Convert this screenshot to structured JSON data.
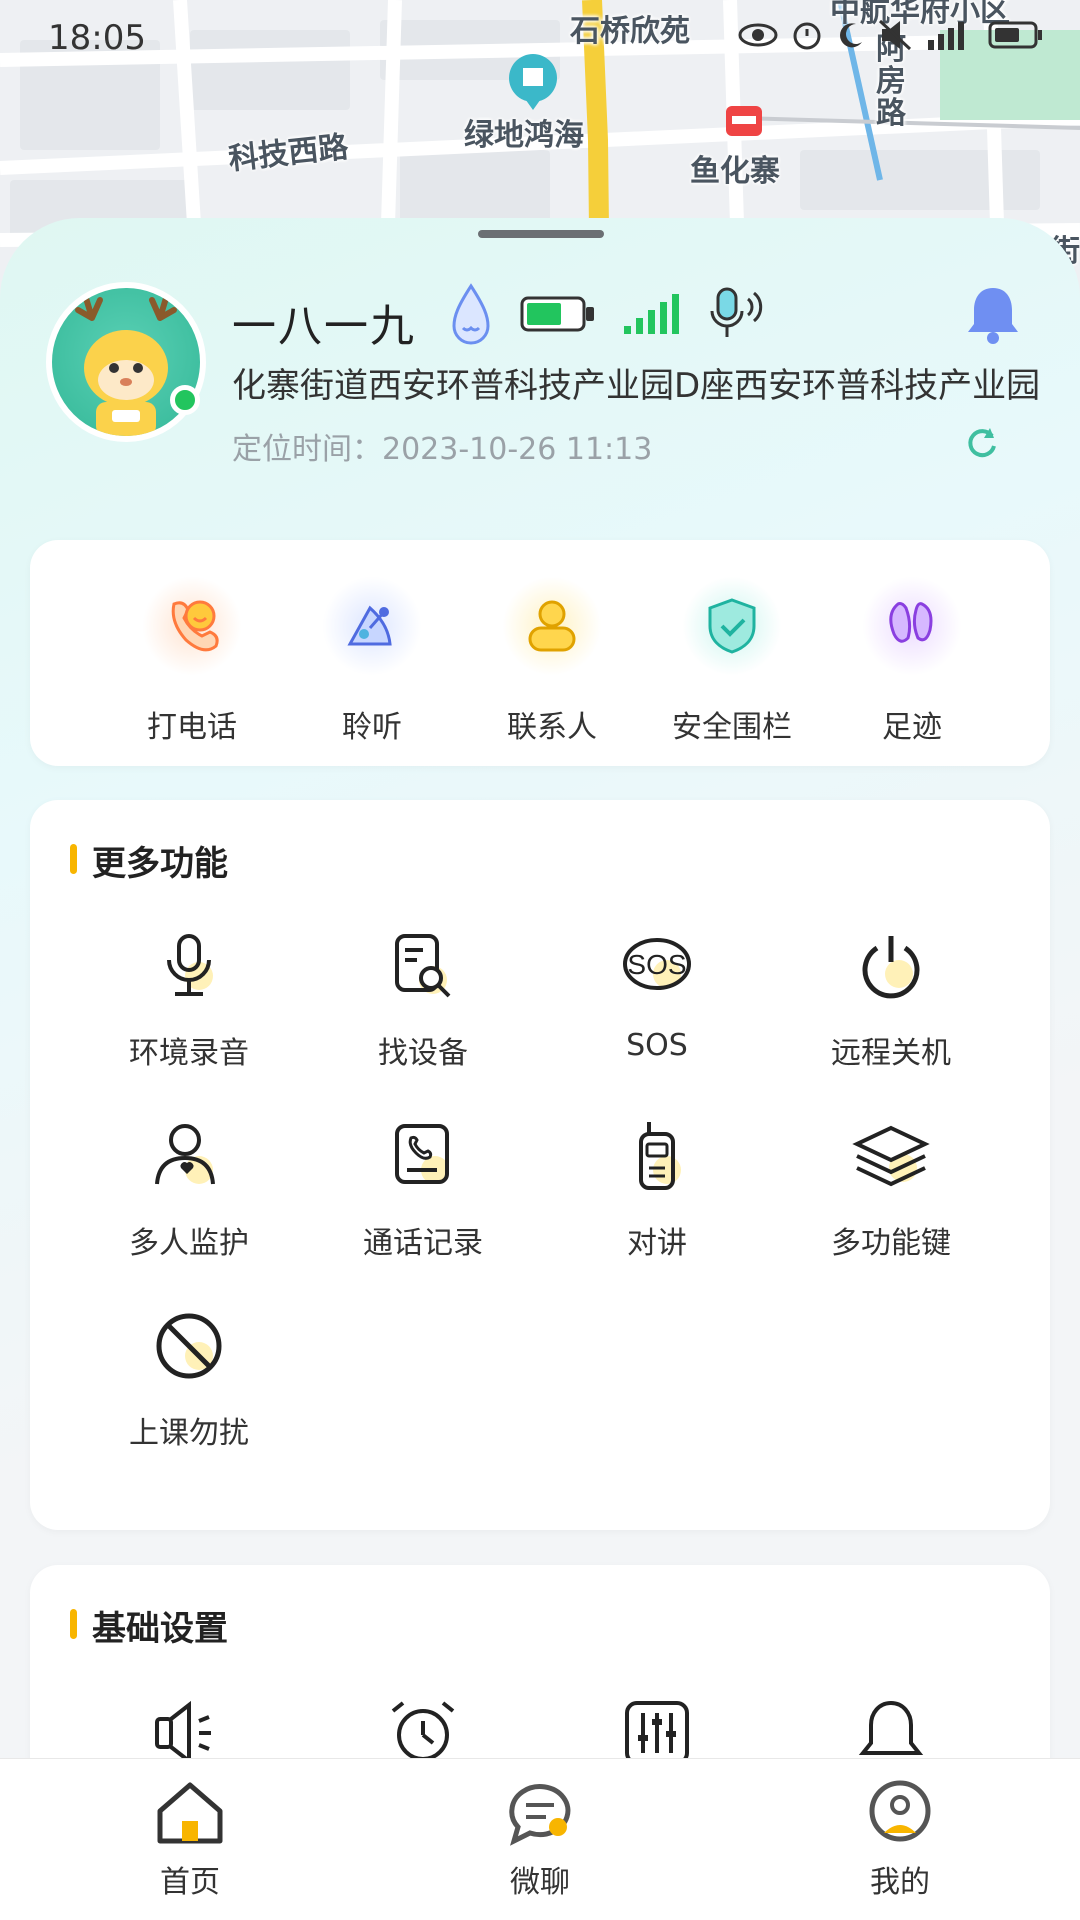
{
  "status_bar": {
    "time": "18:05"
  },
  "map": {
    "labels": [
      "石桥欣苑",
      "中航华府小区",
      "科技西路",
      "绿地鸿海",
      "鱼化寨",
      "阿房路",
      "街"
    ]
  },
  "device": {
    "name": "一八一九",
    "address": "化寨街道西安环普科技产业园D座西安环普科技产业园",
    "location_time": "定位时间：2023-10-26 11:13"
  },
  "quick_actions": [
    {
      "label": "打电话",
      "icon": "phone-icon"
    },
    {
      "label": "聆听",
      "icon": "satellite-icon"
    },
    {
      "label": "联系人",
      "icon": "contact-icon"
    },
    {
      "label": "安全围栏",
      "icon": "shield-icon"
    },
    {
      "label": "足迹",
      "icon": "footprint-icon"
    }
  ],
  "more_functions": {
    "title": "更多功能",
    "items": [
      {
        "label": "环境录音",
        "icon": "microphone-icon"
      },
      {
        "label": "找设备",
        "icon": "find-device-icon"
      },
      {
        "label": "SOS",
        "icon": "sos-icon",
        "icon_text": "SOS"
      },
      {
        "label": "远程关机",
        "icon": "power-icon"
      },
      {
        "label": "多人监护",
        "icon": "guardian-icon"
      },
      {
        "label": "通话记录",
        "icon": "call-log-icon"
      },
      {
        "label": "对讲",
        "icon": "walkie-talkie-icon"
      },
      {
        "label": "多功能键",
        "icon": "layers-icon"
      },
      {
        "label": "上课勿扰",
        "icon": "do-not-disturb-icon"
      }
    ]
  },
  "basic_settings": {
    "title": "基础设置",
    "items": [
      {
        "icon": "speaker-icon"
      },
      {
        "icon": "alarm-clock-icon"
      },
      {
        "icon": "sliders-icon"
      },
      {
        "icon": "bell-icon"
      }
    ]
  },
  "bottom_nav": [
    {
      "label": "首页",
      "icon": "home-icon",
      "active": true
    },
    {
      "label": "微聊",
      "icon": "chat-icon",
      "active": false
    },
    {
      "label": "我的",
      "icon": "profile-icon",
      "active": false
    }
  ],
  "colors": {
    "accent": "#f8b500",
    "map_road": "#ffffff",
    "highway": "#f5cf3a",
    "online": "#22c55e",
    "teal": "#3fbfa0"
  }
}
